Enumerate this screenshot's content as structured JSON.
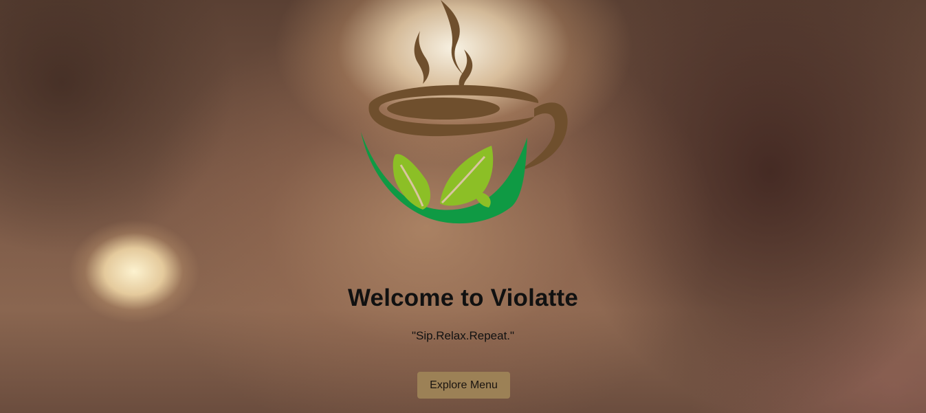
{
  "brand": {
    "logo_icon": "coffee-cup-with-leaves-logo",
    "colors": {
      "cup_brown": "#6f4f2d",
      "leaf_dark_green": "#0f9a44",
      "leaf_light_green": "#8cbf26"
    }
  },
  "hero": {
    "title": "Welcome to Violatte",
    "tagline": "\"Sip.Relax.Repeat.\"",
    "cta_label": "Explore Menu",
    "cta_color": "#9c8156"
  }
}
